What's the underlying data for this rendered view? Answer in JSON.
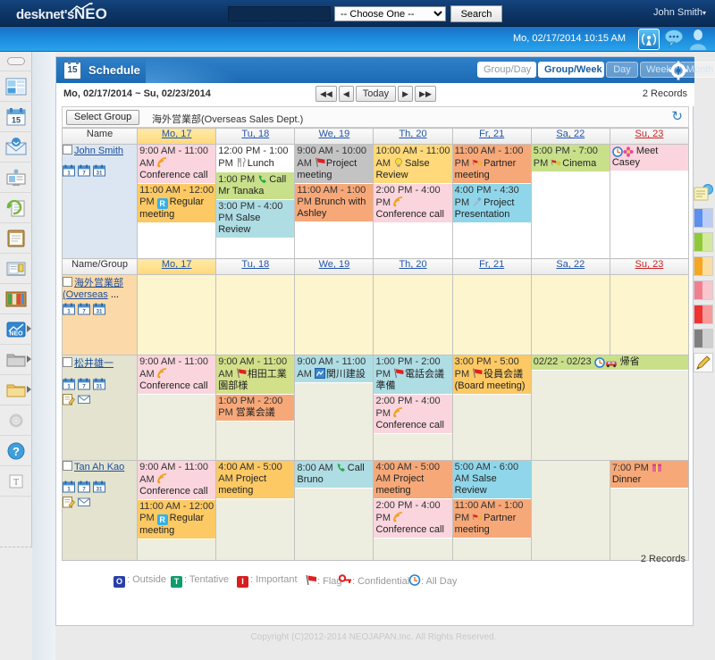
{
  "topbar": {
    "logo_desknets": "desknet's",
    "logo_neo": "NEO",
    "search_value": "",
    "search_placeholder": "",
    "select_value": "-- Choose One --",
    "select_options": [
      "-- Choose One --"
    ],
    "search_button": "Search",
    "user_name": "John Smith",
    "user_caret": "▾"
  },
  "secondbar": {
    "datetime": "Mo, 02/17/2014 10:15 AM",
    "icons": [
      "broadcast-icon",
      "chat-icon",
      "person-icon"
    ]
  },
  "leftbar": {
    "items": [
      {
        "name": "collapse-pill",
        "label": ""
      },
      {
        "name": "portal-icon",
        "label": ""
      },
      {
        "name": "schedule-icon",
        "label": "15"
      },
      {
        "name": "webmail-icon",
        "label": ""
      },
      {
        "name": "facility-icon",
        "label": ""
      },
      {
        "name": "workflow-icon",
        "label": ""
      },
      {
        "name": "bulletin-icon",
        "label": ""
      },
      {
        "name": "circular-icon",
        "label": ""
      },
      {
        "name": "cabinet-icon",
        "label": ""
      },
      {
        "name": "neo-icon",
        "label": "NEO"
      },
      {
        "name": "folder-gray-icon",
        "label": ""
      },
      {
        "name": "folder-yellow-icon",
        "label": ""
      },
      {
        "name": "settings-icon",
        "label": ""
      },
      {
        "name": "help-icon",
        "label": ""
      },
      {
        "name": "text-icon",
        "label": "T"
      }
    ]
  },
  "app": {
    "title": "Schedule",
    "badge_day": "15",
    "views": [
      {
        "label": "Group/Day",
        "active": false,
        "dim": false
      },
      {
        "label": "Group/Week",
        "active": true,
        "dim": false
      },
      {
        "label": "Day",
        "active": false,
        "dim": true
      },
      {
        "label": "Week",
        "active": false,
        "dim": true
      },
      {
        "label": "Month",
        "active": false,
        "dim": true
      }
    ],
    "gear": "gear-icon"
  },
  "daterow": {
    "range": "Mo, 02/17/2014 ~ Su, 02/23/2014",
    "nav": [
      {
        "name": "prev-page-button",
        "label": "◀◀"
      },
      {
        "name": "prev-button",
        "label": "◀"
      },
      {
        "name": "today-button",
        "label": "Today"
      },
      {
        "name": "next-button",
        "label": "▶"
      },
      {
        "name": "next-page-button",
        "label": "▶▶"
      }
    ],
    "records_top": "2 Records",
    "records_bottom": "2 Records"
  },
  "grouprow": {
    "select_group_button": "Select Group",
    "group_name": "海外営業部(Overseas Sales Dept.)",
    "refresh": "↻"
  },
  "columns": [
    {
      "label": "Mo, 17",
      "kind": "today"
    },
    {
      "label": "Tu, 18",
      "kind": "weekday"
    },
    {
      "label": "We, 19",
      "kind": "weekday"
    },
    {
      "label": "Th, 20",
      "kind": "weekday"
    },
    {
      "label": "Fr, 21",
      "kind": "weekday"
    },
    {
      "label": "Sa, 22",
      "kind": "sat"
    },
    {
      "label": "Su, 23",
      "kind": "sun"
    }
  ],
  "header_name": "Name",
  "header_name_group": "Name/Group",
  "rows": [
    {
      "kind": "person",
      "name": "John Smith",
      "name_extra": "",
      "days": [
        [
          {
            "time": "9:00 AM - 11:00 AM",
            "title": "Conference call",
            "icon": "rss-icon",
            "bg": "#fad5dd"
          },
          {
            "time": "11:00 AM - 12:00 PM",
            "title": "Regular meeting",
            "icon": "r-badge",
            "bg": "#fcc964"
          }
        ],
        [
          {
            "time": "12:00 PM - 1:00 PM",
            "title": "Lunch",
            "icon": "cutlery-icon",
            "bg": "#ffffff"
          },
          {
            "time": "1:00 PM",
            "title": "Call Mr Tanaka",
            "icon": "phone-icon",
            "bg": "#c8e08a"
          },
          {
            "time": "3:00 PM - 4:00 PM",
            "title": "Salse Review",
            "icon": "",
            "bg": "#aedde4"
          }
        ],
        [
          {
            "time": "9:00 AM - 10:00 AM",
            "title": "Project meeting",
            "icon": "flag-icon",
            "bg": "#c3c3c3"
          },
          {
            "time": "11:00 AM - 1:00 PM",
            "title": "Brunch with Ashley",
            "icon": "",
            "bg": "#f7a878"
          }
        ],
        [
          {
            "time": "10:00 AM - 11:00 AM",
            "title": "Salse Review",
            "icon": "bulb-icon",
            "bg": "#ffd97a"
          },
          {
            "time": "2:00 PM - 4:00 PM",
            "title": "Conference call",
            "icon": "rss-icon",
            "bg": "#fad5dd"
          }
        ],
        [
          {
            "time": "11:00 AM - 1:00 PM",
            "title": "Partner meeting",
            "icon": "flag-star-icon",
            "bg": "#f7a878"
          },
          {
            "time": "4:00 PM - 4:30 PM",
            "title": "Project Presentation",
            "icon": "mic-icon",
            "bg": "#8fd6ea"
          }
        ],
        [
          {
            "time": "5:00 PM - 7:00 PM",
            "title": "Cinema",
            "icon": "flag-star-icon",
            "bg": "#c8e08a"
          }
        ],
        [
          {
            "time": "",
            "title": "Meet Casey",
            "icon": "allday-flower-icon",
            "bg": "#fad5dd"
          }
        ]
      ]
    },
    {
      "kind": "group",
      "name": "海外営業部",
      "name_extra": "(Overseas",
      "ellipsis": "...",
      "days": [
        [],
        [],
        [],
        [],
        [],
        [],
        []
      ]
    },
    {
      "kind": "person2",
      "name": "松井雄一",
      "name_extra": "",
      "days": [
        [
          {
            "time": "9:00 AM - 11:00 AM",
            "title": "Conference call",
            "icon": "rss-icon",
            "bg": "#fad5dd"
          }
        ],
        [
          {
            "time": "9:00 AM - 11:00 AM",
            "title": "相田工業 園部様",
            "icon": "flag-icon",
            "bg": "#d3e08a"
          },
          {
            "time": "1:00 PM - 2:00 PM",
            "title": "営業会議",
            "icon": "",
            "bg": "#f7a878"
          }
        ],
        [
          {
            "time": "9:00 AM - 11:00 AM",
            "title": "関川建設",
            "icon": "blue-badge-icon",
            "bg": "#aedde4"
          }
        ],
        [
          {
            "time": "1:00 PM - 2:00 PM",
            "title": "電話会議準備",
            "icon": "flag-icon",
            "bg": "#aedde4"
          },
          {
            "time": "2:00 PM - 4:00 PM",
            "title": "Conference call",
            "icon": "rss-icon",
            "bg": "#fad5dd"
          }
        ],
        [
          {
            "time": "3:00 PM - 5:00 PM",
            "title": "役員会議(Board meeting)",
            "icon": "flag-icon",
            "bg": "#fcc964"
          }
        ],
        [
          {
            "time": "02/22 - 02/23",
            "title": "帰省",
            "icon": "allday-car-icon",
            "bg": "#c8e08a",
            "span": 2
          }
        ],
        []
      ]
    },
    {
      "kind": "person2",
      "name": "Tan Ah Kao",
      "name_extra": "",
      "days": [
        [
          {
            "time": "9:00 AM - 11:00 AM",
            "title": "Conference call",
            "icon": "rss-icon",
            "bg": "#fad5dd"
          },
          {
            "time": "11:00 AM - 12:00 PM",
            "title": "Regular meeting",
            "icon": "r-badge",
            "bg": "#fcc964"
          }
        ],
        [
          {
            "time": "4:00 AM - 5:00 AM",
            "title": "Project meeting",
            "icon": "",
            "bg": "#fcc964"
          }
        ],
        [
          {
            "time": "8:00 AM",
            "title": "Call Bruno",
            "icon": "phone-icon",
            "bg": "#aedde4"
          }
        ],
        [
          {
            "time": "4:00 AM - 5:00 AM",
            "title": "Project meeting",
            "icon": "",
            "bg": "#f7a878"
          },
          {
            "time": "2:00 PM - 4:00 PM",
            "title": "Conference call",
            "icon": "rss-icon",
            "bg": "#fad5dd"
          }
        ],
        [
          {
            "time": "5:00 AM - 6:00 AM",
            "title": "Salse Review",
            "icon": "",
            "bg": "#8fd6ea"
          },
          {
            "time": "11:00 AM - 1:00 PM",
            "title": "Partner meeting",
            "icon": "flag-star-icon",
            "bg": "#f7a878"
          }
        ],
        [],
        [
          {
            "time": "7:00 PM",
            "title": "Dinner",
            "icon": "gift-icon",
            "bg": "#f7a878"
          }
        ]
      ]
    }
  ],
  "legend": [
    {
      "name": "outside",
      "glyph": "O",
      "color": "#2a3fa8",
      "label": ": Outside"
    },
    {
      "name": "tentative",
      "glyph": "T",
      "color": "#0f9b6c",
      "label": ": Tentative"
    },
    {
      "name": "important",
      "glyph": "I",
      "color": "#d62020",
      "label": ": Important"
    },
    {
      "name": "flag",
      "glyph": "",
      "color": "",
      "label": ": Flag"
    },
    {
      "name": "confidential",
      "glyph": "",
      "color": "",
      "label": ": Confidential"
    },
    {
      "name": "allday",
      "glyph": "",
      "color": "",
      "label": ": All Day"
    }
  ],
  "rightrail": {
    "swatches": [
      "#5b8ff0",
      "#8fc93a",
      "#f5a623",
      "#f08090",
      "#ee3333",
      "#808080"
    ],
    "note_icon": "note-icon",
    "pencil_icon": "pencil-icon"
  },
  "copyright": "Copyright (C)2012-2014 NEOJAPAN,Inc. All Rights Reserved."
}
